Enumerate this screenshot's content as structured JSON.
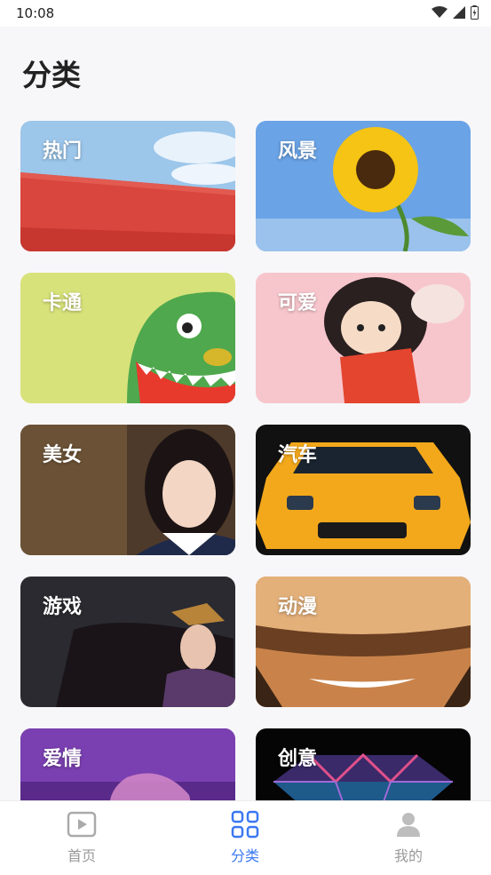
{
  "status_bar": {
    "time": "10:08",
    "icons": [
      "wifi-icon",
      "signal-icon",
      "battery-icon"
    ]
  },
  "page": {
    "title": "分类"
  },
  "categories": [
    {
      "label": "热门"
    },
    {
      "label": "风景"
    },
    {
      "label": "卡通"
    },
    {
      "label": "可爱"
    },
    {
      "label": "美女"
    },
    {
      "label": "汽车"
    },
    {
      "label": "游戏"
    },
    {
      "label": "动漫"
    },
    {
      "label": "爱情"
    },
    {
      "label": "创意"
    }
  ],
  "bottom_nav": {
    "items": [
      {
        "label": "首页",
        "icon": "play-icon",
        "active": false
      },
      {
        "label": "分类",
        "icon": "grid-icon",
        "active": true
      },
      {
        "label": "我的",
        "icon": "user-icon",
        "active": false
      }
    ],
    "active_color": "#3a78f2",
    "inactive_color": "#9a9a9a"
  }
}
